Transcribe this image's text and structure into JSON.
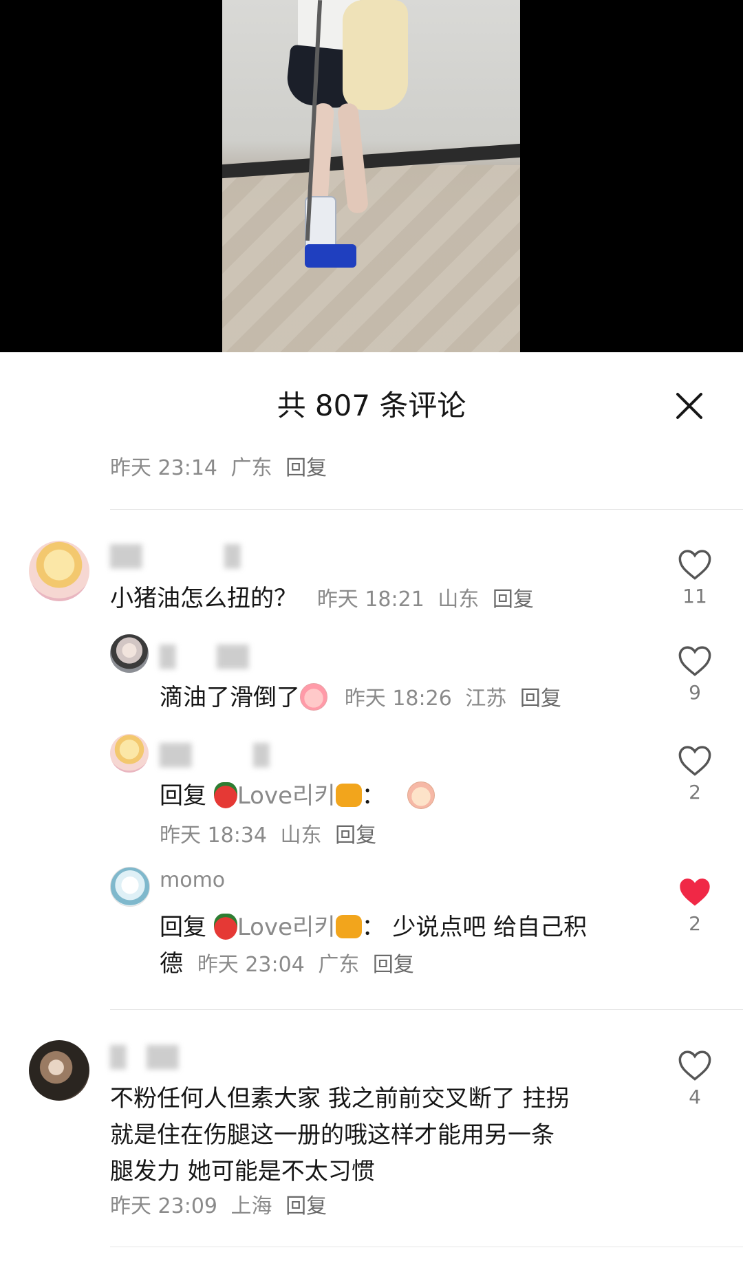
{
  "sheet": {
    "title": "共 807 条评论"
  },
  "first_meta": {
    "time": "昨天 23:14",
    "location": "广东",
    "reply": "回复"
  },
  "comments": [
    {
      "text": "小猪油怎么扭的？",
      "time": "昨天 18:21",
      "location": "山东",
      "reply": "回复",
      "likes": "11",
      "replies": [
        {
          "text": "滴油了滑倒了",
          "time": "昨天 18:26",
          "location": "江苏",
          "reply": "回复",
          "likes": "9"
        },
        {
          "prefix": "回复",
          "mention": "Love리키",
          "text": "：",
          "time": "昨天 18:34",
          "location": "山东",
          "reply": "回复",
          "likes": "2"
        },
        {
          "name": "momo",
          "prefix": "回复",
          "mention": "Love리키",
          "text": "：  少说点吧 给自己积",
          "text2": "德",
          "time": "昨天 23:04",
          "location": "广东",
          "reply": "回复",
          "likes": "2",
          "liked": true
        }
      ]
    },
    {
      "line1": "不粉任何人但素大家 我之前前交叉断了 拄拐",
      "line2": "就是住在伤腿这一册的哦这样才能用另一条",
      "line3": "腿发力 她可能是不太习惯",
      "time": "昨天 23:09",
      "location": "上海",
      "reply": "回复",
      "likes": "4"
    }
  ],
  "colors": {
    "like_active": "#f02846",
    "meta": "#8a8a8a",
    "text": "#161616"
  },
  "icons": {
    "close": "close-icon",
    "like": "heart-icon"
  }
}
